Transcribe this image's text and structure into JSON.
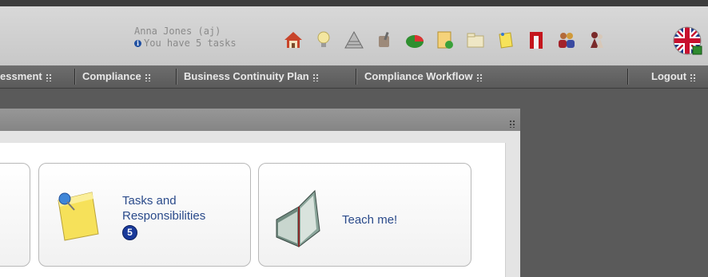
{
  "user": {
    "name": "Anna Jones (aj)",
    "tasks_notice": "You have 5 tasks"
  },
  "toolbar_icons": [
    "home-icon",
    "lightbulb-icon",
    "pyramid-icon",
    "cup-icon",
    "pie-chart-icon",
    "document-check-icon",
    "folder-icon",
    "notes-icon",
    "fire-extinguisher-icon",
    "users-icon",
    "pawn-icon"
  ],
  "language_flag": "uk-flag-icon",
  "nav": {
    "items": [
      "essment",
      "Compliance",
      "Business Continuity Plan",
      "Compliance Workflow"
    ],
    "logout": "Logout"
  },
  "tiles": [
    {
      "label_line1": "Tasks and",
      "label_line2": "Responsibilities",
      "badge": "5"
    },
    {
      "label": "Teach me!"
    }
  ],
  "colors": {
    "link_text": "#2a4a8a",
    "badge": "#1a3a9a",
    "nav_bg": "#5a5a5a"
  }
}
